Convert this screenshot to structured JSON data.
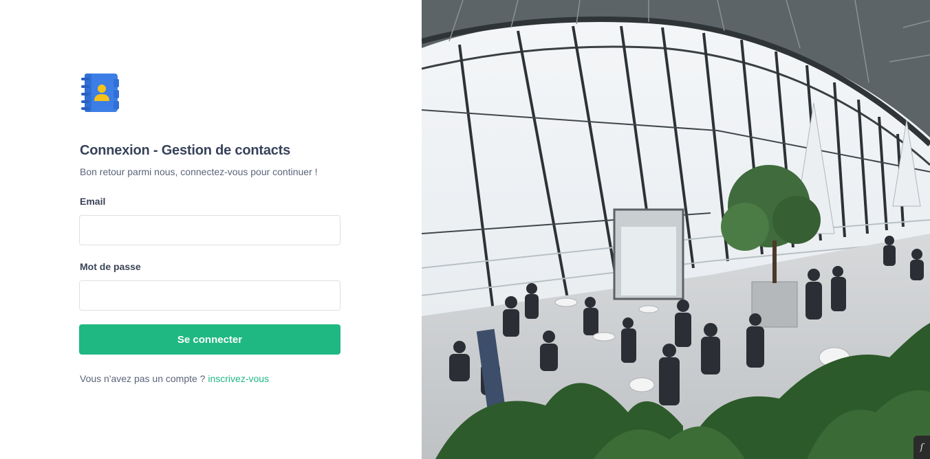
{
  "login": {
    "title": "Connexion - Gestion de contacts",
    "subtitle": "Bon retour parmi nous, connectez-vous pour continuer !",
    "email_label": "Email",
    "email_value": "",
    "password_label": "Mot de passe",
    "password_value": "",
    "submit_label": "Se connecter",
    "signup_prompt": "Vous n'avez pas un compte ?",
    "signup_link": "inscrivez-vous"
  },
  "icons": {
    "logo": "contact-book-icon",
    "corner_badge": "symfony-icon"
  },
  "colors": {
    "accent": "#1fb882",
    "title": "#37425a",
    "logo_blue": "#3d7ee6",
    "logo_yellow": "#f6c21a"
  }
}
